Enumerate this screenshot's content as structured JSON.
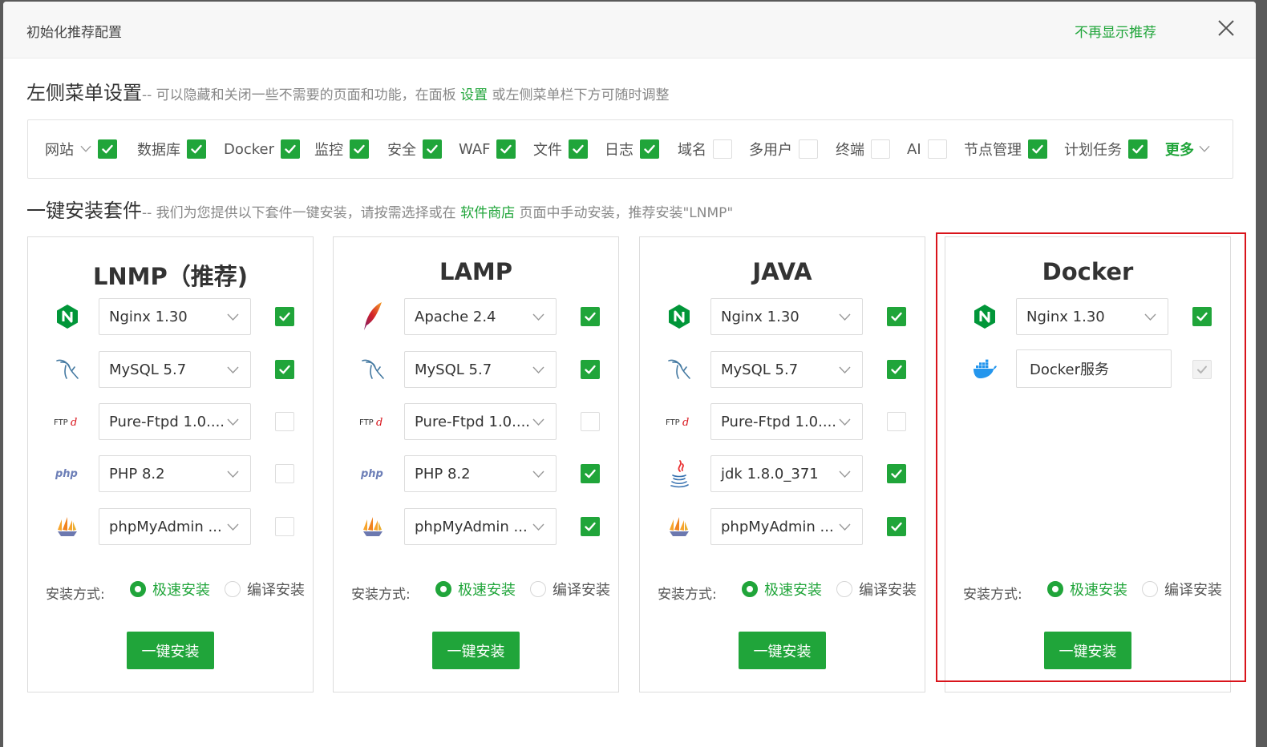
{
  "dialog": {
    "title": "初始化推荐配置",
    "dismiss_label": "不再显示推荐"
  },
  "menu_section": {
    "title": "左侧菜单设置",
    "desc_prefix": "-- 可以隐藏和关闭一些不需要的页面和功能，在面板 ",
    "desc_link": "设置",
    "desc_suffix": " 或左侧菜单栏下方可随时调整",
    "items": [
      {
        "label": "网站",
        "checked": true,
        "dropdown": true
      },
      {
        "label": "数据库",
        "checked": true
      },
      {
        "label": "Docker",
        "checked": true
      },
      {
        "label": "监控",
        "checked": true
      },
      {
        "label": "安全",
        "checked": true
      },
      {
        "label": "WAF",
        "checked": true
      },
      {
        "label": "文件",
        "checked": true
      },
      {
        "label": "日志",
        "checked": true
      },
      {
        "label": "域名",
        "checked": false
      },
      {
        "label": "多用户",
        "checked": false
      },
      {
        "label": "终端",
        "checked": false
      },
      {
        "label": "AI",
        "checked": false
      },
      {
        "label": "节点管理",
        "checked": true
      },
      {
        "label": "计划任务",
        "checked": true
      }
    ],
    "more_label": "更多"
  },
  "install_section": {
    "title": "一键安装套件",
    "desc_prefix": "-- 我们为您提供以下套件一键安装，请按需选择或在 ",
    "desc_link": "软件商店",
    "desc_suffix": " 页面中手动安装，推荐安装\"LNMP\"",
    "method_label": "安装方式:",
    "fast_label": "极速安装",
    "compile_label": "编译安装",
    "install_button": "一键安装"
  },
  "stacks": [
    {
      "title": "LNMP（推荐)",
      "items": [
        {
          "icon": "nginx-icon",
          "value": "Nginx 1.30",
          "checked": true
        },
        {
          "icon": "mysql-icon",
          "value": "MySQL 5.7",
          "checked": true
        },
        {
          "icon": "ftp-icon",
          "value": "Pure-Ftpd 1.0....",
          "checked": false
        },
        {
          "icon": "php-icon",
          "value": "PHP 8.2",
          "checked": false
        },
        {
          "icon": "phpmyadmin-icon",
          "value": "phpMyAdmin ...",
          "checked": false
        }
      ]
    },
    {
      "title": "LAMP",
      "items": [
        {
          "icon": "apache-icon",
          "value": "Apache 2.4",
          "checked": true
        },
        {
          "icon": "mysql-icon",
          "value": "MySQL 5.7",
          "checked": true
        },
        {
          "icon": "ftp-icon",
          "value": "Pure-Ftpd 1.0....",
          "checked": false
        },
        {
          "icon": "php-icon",
          "value": "PHP 8.2",
          "checked": true
        },
        {
          "icon": "phpmyadmin-icon",
          "value": "phpMyAdmin ...",
          "checked": true
        }
      ]
    },
    {
      "title": "JAVA",
      "items": [
        {
          "icon": "nginx-icon",
          "value": "Nginx 1.30",
          "checked": true
        },
        {
          "icon": "mysql-icon",
          "value": "MySQL 5.7",
          "checked": true
        },
        {
          "icon": "ftp-icon",
          "value": "Pure-Ftpd 1.0....",
          "checked": false
        },
        {
          "icon": "java-icon",
          "value": "jdk 1.8.0_371",
          "checked": true
        },
        {
          "icon": "phpmyadmin-icon",
          "value": "phpMyAdmin ...",
          "checked": true
        }
      ]
    },
    {
      "title": "Docker",
      "items": [
        {
          "icon": "nginx-icon",
          "value": "Nginx 1.30",
          "checked": true
        },
        {
          "icon": "docker-icon",
          "value": "Docker服务",
          "checked": true,
          "input": true,
          "disabled": true
        }
      ]
    }
  ],
  "colors": {
    "accent": "#20a53a",
    "highlight": "#d9141b"
  }
}
